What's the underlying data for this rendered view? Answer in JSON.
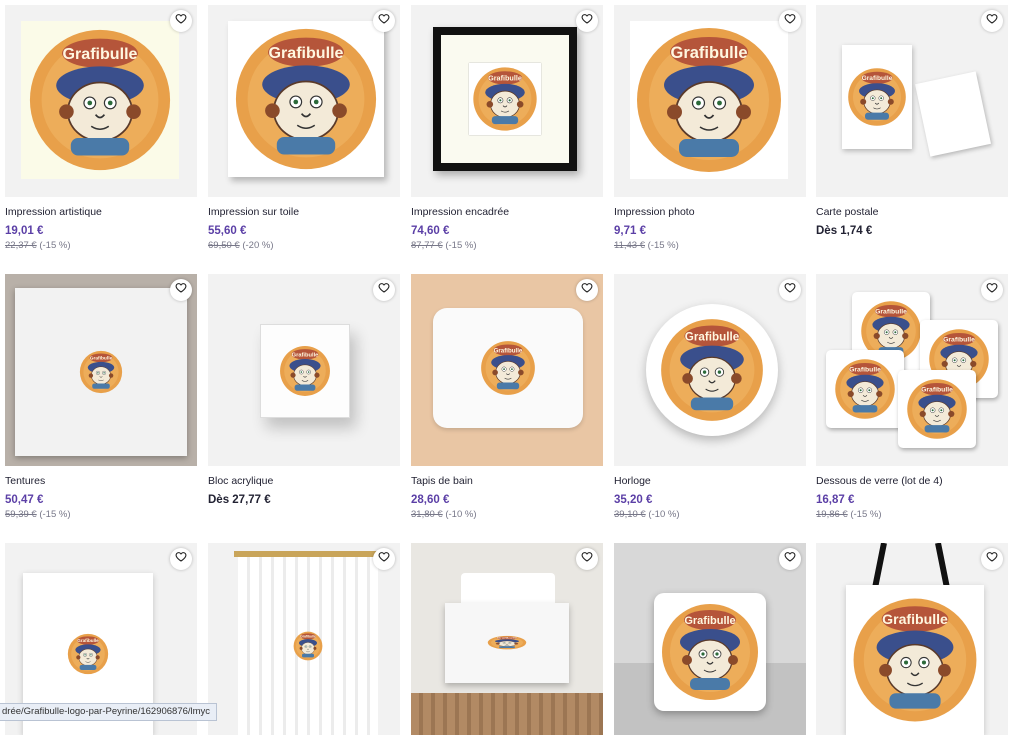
{
  "products": [
    {
      "name": "Impression artistique",
      "price": "19,01 €",
      "old_price": "22,37 €",
      "discount": "(-15 %)",
      "kind": "poster"
    },
    {
      "name": "Impression sur toile",
      "price": "55,60 €",
      "old_price": "69,50 €",
      "discount": "(-20 %)",
      "kind": "canvas"
    },
    {
      "name": "Impression encadrée",
      "price": "74,60 €",
      "old_price": "87,77 €",
      "discount": "(-15 %)",
      "kind": "framed"
    },
    {
      "name": "Impression photo",
      "price": "9,71 €",
      "old_price": "11,43 €",
      "discount": "(-15 %)",
      "kind": "photo"
    },
    {
      "name": "Carte postale",
      "price": "Dès 1,74 €",
      "old_price": "",
      "discount": "",
      "kind": "postcard"
    },
    {
      "name": "Tentures",
      "price": "50,47 €",
      "old_price": "59,39 €",
      "discount": "(-15 %)",
      "kind": "tapestry"
    },
    {
      "name": "Bloc acrylique",
      "price": "Dès 27,77 €",
      "old_price": "",
      "discount": "",
      "kind": "acrylic"
    },
    {
      "name": "Tapis de bain",
      "price": "28,60 €",
      "old_price": "31,80 €",
      "discount": "(-10 %)",
      "kind": "bathmat"
    },
    {
      "name": "Horloge",
      "price": "35,20 €",
      "old_price": "39,10 €",
      "discount": "(-10 %)",
      "kind": "clock"
    },
    {
      "name": "Dessous de verre (lot de 4)",
      "price": "16,87 €",
      "old_price": "19,86 €",
      "discount": "(-15 %)",
      "kind": "coasters"
    },
    {
      "name": "",
      "price": "",
      "old_price": "",
      "discount": "",
      "kind": "duvet"
    },
    {
      "name": "",
      "price": "",
      "old_price": "",
      "discount": "",
      "kind": "curtain"
    },
    {
      "name": "",
      "price": "",
      "old_price": "",
      "discount": "",
      "kind": "bed"
    },
    {
      "name": "",
      "price": "",
      "old_price": "",
      "discount": "",
      "kind": "pillow"
    },
    {
      "name": "",
      "price": "",
      "old_price": "",
      "discount": "",
      "kind": "tote"
    }
  ],
  "design": {
    "logo_text": "Grafibulle"
  },
  "status_url": "drée/Grafibulle-logo-par-Peyrine/162906876/lmyc",
  "colors": {
    "price": "#5b3fa6",
    "logo_orange": "#e8a04a",
    "logo_bubble": "#b5553a",
    "hat_blue": "#3a4f8c"
  }
}
